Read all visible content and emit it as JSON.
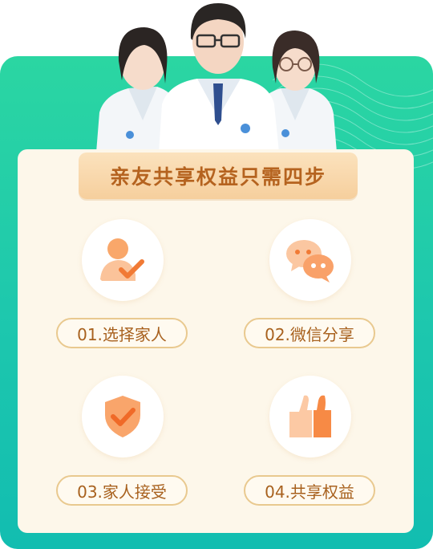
{
  "title": "亲友共享权益只需四步",
  "steps": [
    {
      "label": "01.选择家人",
      "icon": "person-check-icon"
    },
    {
      "label": "02.微信分享",
      "icon": "chat-bubbles-icon"
    },
    {
      "label": "03.家人接受",
      "icon": "shield-check-icon"
    },
    {
      "label": "04.共享权益",
      "icon": "thumbs-up-icon"
    }
  ],
  "colors": {
    "green_top": "#2bd6a2",
    "green_bottom": "#12bdb0",
    "panel": "#fdf7ea",
    "banner": "#f6cf9d",
    "title_text": "#b5631f",
    "icon_orange": "#f78a45",
    "label_border": "#e9c98f"
  }
}
